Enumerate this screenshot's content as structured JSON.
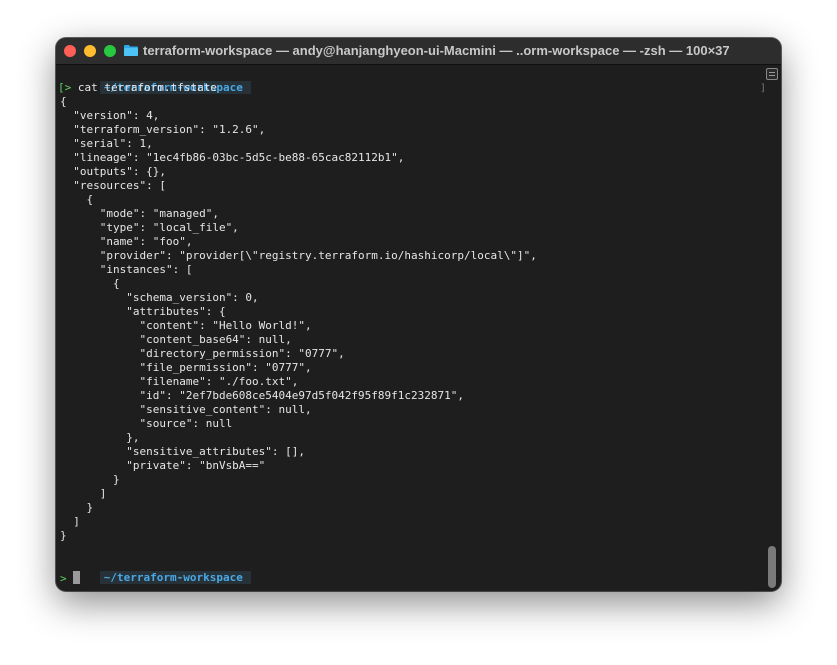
{
  "window": {
    "title": "terraform-workspace — andy@hanjanghyeon-ui-Macmini — ..orm-workspace — -zsh — 100×37"
  },
  "prompt": {
    "path": "~/terraform-workspace",
    "arrow": ">",
    "command": "cat terraform.tfstate"
  },
  "output": [
    "{",
    "  \"version\": 4,",
    "  \"terraform_version\": \"1.2.6\",",
    "  \"serial\": 1,",
    "  \"lineage\": \"1ec4fb86-03bc-5d5c-be88-65cac82112b1\",",
    "  \"outputs\": {},",
    "  \"resources\": [",
    "    {",
    "      \"mode\": \"managed\",",
    "      \"type\": \"local_file\",",
    "      \"name\": \"foo\",",
    "      \"provider\": \"provider[\\\"registry.terraform.io/hashicorp/local\\\"]\",",
    "      \"instances\": [",
    "        {",
    "          \"schema_version\": 0,",
    "          \"attributes\": {",
    "            \"content\": \"Hello World!\",",
    "            \"content_base64\": null,",
    "            \"directory_permission\": \"0777\",",
    "            \"file_permission\": \"0777\",",
    "            \"filename\": \"./foo.txt\",",
    "            \"id\": \"2ef7bde608ce5404e97d5f042f95f89f1c232871\",",
    "            \"sensitive_content\": null,",
    "            \"source\": null",
    "          },",
    "          \"sensitive_attributes\": [],",
    "          \"private\": \"bnVsbA==\"",
    "        }",
    "      ]",
    "    }",
    "  ]",
    "}"
  ],
  "prompt2": {
    "path": "~/terraform-workspace",
    "arrow": ">"
  },
  "marks": {
    "open_bracket": "[",
    "close_bracket": "]"
  },
  "colors": {
    "background": "#1e1e1e",
    "path_text": "#4aa8e6",
    "prompt_arrow": "#5fd35f"
  }
}
